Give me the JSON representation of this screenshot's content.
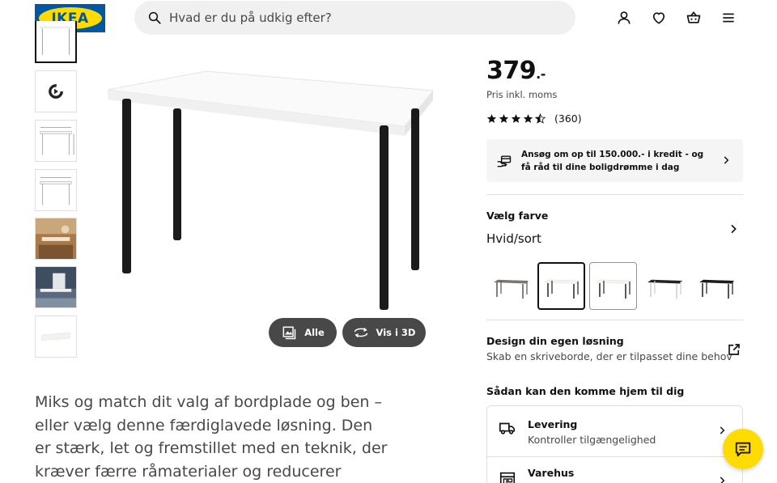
{
  "header": {
    "logo_text": "IKEA",
    "search_placeholder": "Hvad er du på udkig efter?",
    "icons": [
      "user-icon",
      "heart-icon",
      "basket-icon",
      "menu-icon"
    ]
  },
  "gallery": {
    "thumbnails": [
      "product-front",
      "video",
      "dimensions-1",
      "dimensions-2",
      "room-scene-1",
      "room-scene-2",
      "desktop-top"
    ],
    "buttons": {
      "all_label": "Alle",
      "view3d_label": "Vis i 3D"
    }
  },
  "description": "Miks og match dit valg af bordplade og ben – eller vælg denne færdiglavede løsning. Den er stærk, let og fremstillet med en teknik, der kræver færre råmaterialer og reducerer miljøpåvirkningen.",
  "product": {
    "price": "379",
    "price_suffix": ".-",
    "price_note": "Pris inkl. moms",
    "rating": 4.5,
    "review_count": "(360)",
    "credit_text": "Ansøg om op til 150.000.- i kredit - og få råd til dine boligdrømme i dag"
  },
  "color": {
    "title": "Vælg farve",
    "value": "Hvid/sort",
    "swatches": [
      {
        "top": "#7d756e",
        "legs": "#555555"
      },
      {
        "top": "#f5f5f0",
        "legs": "#222222"
      },
      {
        "top": "#f5f5f0",
        "legs": "#222222"
      },
      {
        "top": "#222222",
        "legs": "#dddddd"
      },
      {
        "top": "#1a1a1a",
        "legs": "#1a1a1a"
      }
    ]
  },
  "design": {
    "title": "Design din egen løsning",
    "subtitle": "Skab en skriveborde, der er tilpasset dine behov"
  },
  "delivery": {
    "title": "Sådan kan den komme hjem til dig",
    "rows": [
      {
        "title": "Levering",
        "subtitle": "Kontroller tilgængelighed"
      },
      {
        "title": "Varehus",
        "subtitle": ""
      }
    ]
  },
  "colors": {
    "ikea_blue": "#0058a3",
    "ikea_yellow": "#ffdb00",
    "pill_bg": "#484848"
  }
}
